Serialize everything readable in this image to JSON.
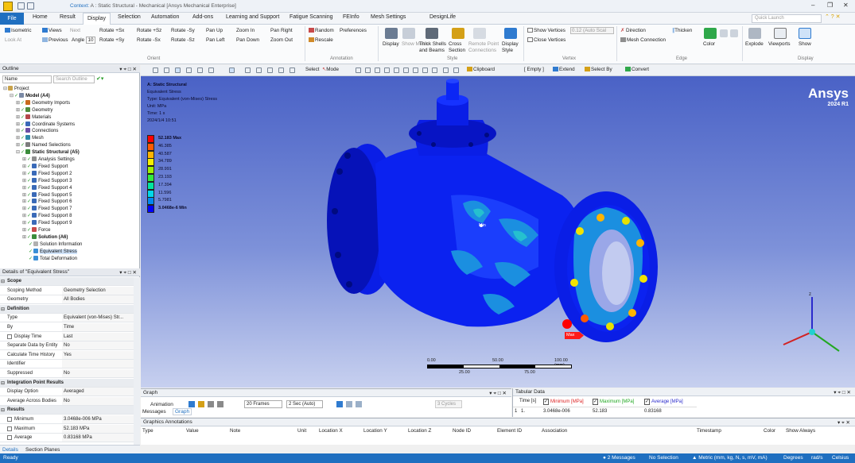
{
  "title_bar": {
    "context_label": "Context:",
    "title": "A : Static Structural - Mechanical [Ansys Mechanical Enterprise]"
  },
  "ribbon_tabs": [
    "File",
    "Home",
    "Result",
    "Display",
    "Selection",
    "Automation",
    "Add-ons",
    "Learning and Support",
    "Fatigue Scanning",
    "FEInfo",
    "Mesh Settings",
    "DesignLife"
  ],
  "active_tab": "Display",
  "quick_launch": {
    "placeholder": "Quick Launch"
  },
  "ribbon": {
    "orient": {
      "isometric": "Isometric",
      "views": "Views",
      "next": "Next",
      "look_at": "Look At",
      "previous": "Previous",
      "angle_label": "Angle",
      "angle_value": "10",
      "rotate_px": "Rotate +Sx",
      "rotate_nx": "Rotate -Sx",
      "rotate_py": "Rotate +Sy",
      "rotate_ny": "Rotate -Sy",
      "rotate_pz": "Rotate +Sz",
      "rotate_nz": "Rotate -Sz",
      "pan_up": "Pan Up",
      "pan_left": "Pan Left",
      "pan_down": "Pan Down",
      "pan_right": "Pan Right",
      "zoom_in": "Zoom In",
      "zoom_out": "Zoom Out",
      "group": "Orient"
    },
    "annotation": {
      "random": "Random",
      "preferences": "Preferences",
      "rescale": "Rescale",
      "group": "Annotation"
    },
    "style": {
      "display": "Display",
      "show_mesh": "Show Mesh",
      "thick_shells": "Thick Shells and Beams",
      "cross_section": "Cross Section",
      "remote_point": "Remote Point Connections",
      "display_style": "Display Style",
      "group": "Style"
    },
    "vertex": {
      "show_vertices": "Show Vertices",
      "vertex_scale": "0.12 (Auto Scal",
      "close_vertices": "Close Vertices",
      "group": "Vertex"
    },
    "edge": {
      "direction": "Direction",
      "thicken": "Thicken",
      "mesh_connection": "Mesh Connection",
      "color": "Color",
      "group": "Edge"
    },
    "display": {
      "explode": "Explode",
      "viewports": "Viewports",
      "show": "Show",
      "group": "Display"
    }
  },
  "graphics_toolbar": {
    "select": "Select",
    "mode": "Mode",
    "clipboard": "Clipboard",
    "empty": "[ Empty ]",
    "extend": "Extend",
    "select_by": "Select By",
    "convert": "Convert"
  },
  "outline": {
    "header": "Outline",
    "name_dropdown": "Name",
    "search_placeholder": "Search Outline",
    "items": [
      {
        "label": "Project",
        "level": 0,
        "color": "#c8a24a"
      },
      {
        "label": "Model (A4)",
        "level": 1,
        "color": "#7a8aa6",
        "bold": true
      },
      {
        "label": "Geometry Imports",
        "level": 2,
        "color": "#c86a1c"
      },
      {
        "label": "Geometry",
        "level": 2,
        "color": "#4f8c3c"
      },
      {
        "label": "Materials",
        "level": 2,
        "color": "#b5474a"
      },
      {
        "label": "Coordinate Systems",
        "level": 2,
        "color": "#3a6ab8"
      },
      {
        "label": "Connections",
        "level": 2,
        "color": "#6b4fa5"
      },
      {
        "label": "Mesh",
        "level": 2,
        "color": "#2f8aa8"
      },
      {
        "label": "Named Selections",
        "level": 2,
        "color": "#7d7d7d"
      },
      {
        "label": "Static Structural (A5)",
        "level": 2,
        "color": "#3b8c3b",
        "bold": true
      },
      {
        "label": "Analysis Settings",
        "level": 3,
        "color": "#8e8e8e"
      },
      {
        "label": "Fixed Support",
        "level": 3,
        "color": "#3a6ab8"
      },
      {
        "label": "Fixed Support 2",
        "level": 3,
        "color": "#3a6ab8"
      },
      {
        "label": "Fixed Support 3",
        "level": 3,
        "color": "#3a6ab8"
      },
      {
        "label": "Fixed Support 4",
        "level": 3,
        "color": "#3a6ab8"
      },
      {
        "label": "Fixed Support 5",
        "level": 3,
        "color": "#3a6ab8"
      },
      {
        "label": "Fixed Support 6",
        "level": 3,
        "color": "#3a6ab8"
      },
      {
        "label": "Fixed Support 7",
        "level": 3,
        "color": "#3a6ab8"
      },
      {
        "label": "Fixed Support 8",
        "level": 3,
        "color": "#3a6ab8"
      },
      {
        "label": "Fixed Support 9",
        "level": 3,
        "color": "#3a6ab8"
      },
      {
        "label": "Force",
        "level": 3,
        "color": "#c84a4a"
      },
      {
        "label": "Solution (A6)",
        "level": 3,
        "color": "#3b8c3b",
        "bold": true
      },
      {
        "label": "Solution Information",
        "level": 4,
        "color": "#b0b0b0"
      },
      {
        "label": "Equivalent Stress",
        "level": 4,
        "color": "#3a8fd6"
      },
      {
        "label": "Total Deformation",
        "level": 4,
        "color": "#3a8fd6"
      }
    ]
  },
  "details": {
    "header": "Details of \"Equivalent Stress\"",
    "rows": [
      {
        "type": "section",
        "k": "Scope"
      },
      {
        "k": "Scoping Method",
        "v": "Geometry Selection"
      },
      {
        "k": "Geometry",
        "v": "All Bodies"
      },
      {
        "type": "section",
        "k": "Definition"
      },
      {
        "k": "Type",
        "v": "Equivalent (von-Mises) Str..."
      },
      {
        "k": "By",
        "v": "Time"
      },
      {
        "k": "Display Time",
        "v": "Last",
        "check": true
      },
      {
        "k": "Separate Data by Entity",
        "v": "No"
      },
      {
        "k": "Calculate Time History",
        "v": "Yes"
      },
      {
        "k": "Identifier",
        "v": ""
      },
      {
        "k": "Suppressed",
        "v": "No"
      },
      {
        "type": "section",
        "k": "Integration Point Results"
      },
      {
        "k": "Display Option",
        "v": "Averaged"
      },
      {
        "k": "Average Across Bodies",
        "v": "No"
      },
      {
        "type": "section",
        "k": "Results"
      },
      {
        "k": "Minimum",
        "v": "3.0468e-006 MPa",
        "check": true
      },
      {
        "k": "Maximum",
        "v": "52.183 MPa",
        "check": true
      },
      {
        "k": "Average",
        "v": "0.83168 MPa",
        "check": true
      }
    ]
  },
  "bottom_tabs": [
    "Details",
    "Section Planes"
  ],
  "viewport": {
    "info": [
      "A: Static Structural",
      "Equivalent Stress",
      "Type: Equivalent (von-Mises) Stress",
      "Unit: MPa",
      "Time: 1 s",
      "2024/1/4 10:51"
    ],
    "legend": [
      {
        "label": "52.183 Max",
        "color": "#ff0000"
      },
      {
        "label": "46.385",
        "color": "#ff5a00"
      },
      {
        "label": "40.587",
        "color": "#ffb400"
      },
      {
        "label": "34.789",
        "color": "#f6f000"
      },
      {
        "label": "28.991",
        "color": "#9ef200"
      },
      {
        "label": "23.193",
        "color": "#32ea3c"
      },
      {
        "label": "17.394",
        "color": "#00e6a0"
      },
      {
        "label": "11.596",
        "color": "#00d8ea"
      },
      {
        "label": "5.7981",
        "color": "#0088f0"
      },
      {
        "label": "3.0468e-6 Min",
        "color": "#0000ff"
      }
    ],
    "logo": "Ansys",
    "version": "2024 R1",
    "min_tag": "Min",
    "max_tag": "Max",
    "scale": {
      "t0": "0.00",
      "t1": "50.00",
      "t2": "100.00 (mm)",
      "t3": "25.00",
      "t4": "75.00"
    }
  },
  "graph_panel": {
    "header": "Graph",
    "animation": "Animation",
    "frames": "20 Frames",
    "duration": "2 Sec (Auto)",
    "cycles": "3 Cycles",
    "tab_messages": "Messages",
    "tab_graph": "Graph"
  },
  "tabular": {
    "header": "Tabular Data",
    "columns": [
      "Time [s]",
      "Minimum [MPa]",
      "Maximum [MPa]",
      "Average [MPa]"
    ],
    "row": {
      "idx": "1",
      "time": "1.",
      "min": "3.0468e-006",
      "max": "52.183",
      "avg": "0.83168"
    }
  },
  "annotations": {
    "header": "Graphics Annotations",
    "columns": [
      "Type",
      "Value",
      "Note",
      "Unit",
      "Location X",
      "Location Y",
      "Location Z",
      "Node ID",
      "Element ID",
      "Association",
      "Timestamp",
      "Color",
      "Show Always"
    ]
  },
  "status": {
    "ready": "Ready",
    "messages": "2 Messages",
    "selection": "No Selection",
    "units": "Metric (mm, kg, N, s, mV, mA)",
    "angle": "Degrees",
    "rate": "rad/s",
    "temp": "Celsius"
  },
  "colors": {
    "accent": "#1f6fc0"
  }
}
